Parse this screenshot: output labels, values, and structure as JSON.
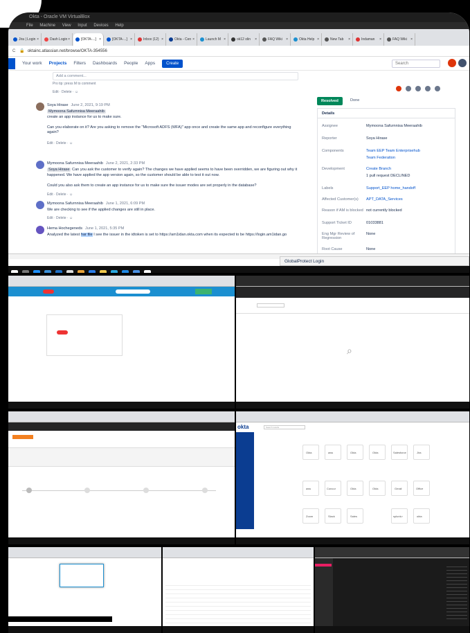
{
  "window": {
    "title": "Okta - Oracle VM VirtualBox",
    "menu": [
      "File",
      "Machine",
      "View",
      "Input",
      "Devices",
      "Help"
    ]
  },
  "browser": {
    "tabs": [
      "Jira | Login",
      "Dash Login",
      "[OKTA-...]",
      "[OKTA-...]",
      "Inbox (12)",
      "Okta - Cen",
      "Launch M",
      "ok12 olin",
      "FAQ Wiki",
      "Okta Help",
      "New Tab",
      "Indaman",
      "FAQ Wiki"
    ],
    "url": "oktainc.atlassian.net/browse/OKTA-354556"
  },
  "jira": {
    "nav": [
      "Your work",
      "Projects",
      "Filters",
      "Dashboards",
      "People",
      "Apps"
    ],
    "create_label": "Create",
    "search_placeholder": "Search"
  },
  "comments": {
    "input_placeholder": "Add a comment...",
    "pro_tip": "Pro tip: press M to comment",
    "edit_delete": "Edit · Delete · ☺",
    "items": [
      {
        "author": "Soya Hirase",
        "date": "June 2, 2021, 9:19 PM",
        "mention": "Mymoona Safurnnisa Meeraahib",
        "text1": "create an app instance for us to make sure.",
        "text2": "Can you elaborate on it? Are you asking to remove the \"Microsoft ADFS (WFA)\" app once and create the same app and reconfigure everything again?"
      },
      {
        "author": "Mymoona Safurnnisa Meeraahib",
        "date": "June 2, 2021, 2:33 PM",
        "mention": "Soya Hirase",
        "text1": "Can you ask the customer to verify again? The changes we have applied seems to have been overridden, we are figuring out why it happened. We have applied the app version again, so the customer should be able to test it out now.",
        "text2": "Could you also ask them to create an app instance for us to make sure the issuer modes are set properly in the database?"
      },
      {
        "author": "Mymoona Safurnnisa Meeraahib",
        "date": "June 1, 2021, 6:09 PM",
        "text1": "We are checking to see if the applied changes are still in place."
      },
      {
        "author": "Hema Hochegeneds",
        "date": "June 1, 2021, 5:35 PM",
        "text_before": "Analyzed the latest",
        "highlight": "har file",
        "text_after": "I see the issuer in the idtoken is set to https://am1idan.okta.com when its expected to be https://login.am1idan.go"
      }
    ]
  },
  "issue": {
    "status": "Resolved",
    "done": "Done",
    "details_label": "Details",
    "fields": [
      {
        "k": "Assignee",
        "v": "Mymoona Safurnnisa Meeraahib"
      },
      {
        "k": "Reporter",
        "v": "Soya Hirase"
      },
      {
        "k": "Components",
        "v": "Team EEP  Team Enterprisehub"
      },
      {
        "k": "",
        "v": "Team Federation"
      },
      {
        "k": "Development",
        "v": "Create Branch"
      },
      {
        "k": "",
        "v": "1 pull request   DECLINED"
      },
      {
        "k": "Labels",
        "v": "Support_EEP  home_handoff"
      },
      {
        "k": "Affected Customer(s)",
        "v": "APT_DATA_Services"
      },
      {
        "k": "Reason if AM is blocked",
        "v": "not currently blocked"
      },
      {
        "k": "Support Ticket ID",
        "v": "01033881"
      },
      {
        "k": "Eng Mgr Review of Regression",
        "v": "None"
      },
      {
        "k": "Root Cause",
        "v": "None"
      }
    ]
  },
  "globalprotect": "GlobalProtect Login",
  "thumbs": {
    "okta_label": "okta",
    "search_placeholder": "Search results",
    "apps": [
      "Okta",
      "aws",
      "Okta",
      "Okta",
      "Salesforce",
      "Jira",
      "aws",
      "Concur",
      "Okta",
      "Okta",
      "Gmail",
      "Office",
      "Zoom",
      "Slack",
      "Sales",
      "splunk>",
      "okta"
    ]
  },
  "colors": {
    "jira_blue": "#0052cc",
    "resolved": "#00875a",
    "okta_blue": "#0b3d91",
    "taskbar": "#101010"
  }
}
